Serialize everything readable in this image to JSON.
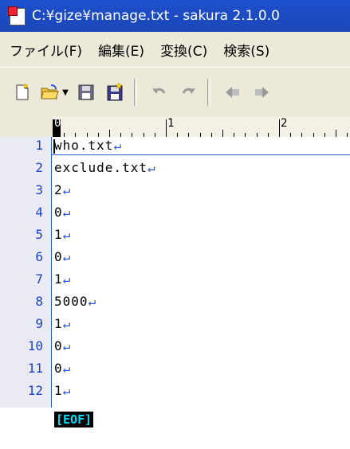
{
  "window": {
    "title": "C:¥gize¥manage.txt - sakura 2.1.0.0",
    "icon": "sakura-app-icon"
  },
  "menu": {
    "items": [
      {
        "label": "ファイル(F)"
      },
      {
        "label": "編集(E)"
      },
      {
        "label": "変換(C)"
      },
      {
        "label": "検索(S)"
      }
    ]
  },
  "toolbar": {
    "buttons": [
      {
        "icon": "new-file-icon"
      },
      {
        "icon": "open-folder-icon"
      },
      {
        "icon": "save-icon"
      },
      {
        "icon": "save-all-icon"
      },
      {
        "icon": "undo-icon"
      },
      {
        "icon": "redo-icon"
      },
      {
        "icon": "jump-back-icon"
      },
      {
        "icon": "jump-forward-icon"
      }
    ]
  },
  "ruler": {
    "labels": [
      "0",
      "1",
      "2"
    ]
  },
  "editor": {
    "eol_mark": "↵",
    "eof_label": "[EOF]",
    "lines": [
      {
        "num": "1",
        "text": "who.txt"
      },
      {
        "num": "2",
        "text": "exclude.txt"
      },
      {
        "num": "3",
        "text": "2"
      },
      {
        "num": "4",
        "text": "0"
      },
      {
        "num": "5",
        "text": "1"
      },
      {
        "num": "6",
        "text": "0"
      },
      {
        "num": "7",
        "text": "1"
      },
      {
        "num": "8",
        "text": "5000"
      },
      {
        "num": "9",
        "text": "1"
      },
      {
        "num": "10",
        "text": "0"
      },
      {
        "num": "11",
        "text": "0"
      },
      {
        "num": "12",
        "text": "1"
      }
    ]
  },
  "colors": {
    "title_bar": "#1e50cc",
    "chrome": "#ece9d8",
    "line_numbers": "#1d44c8",
    "eof_text": "#00e0ff"
  }
}
